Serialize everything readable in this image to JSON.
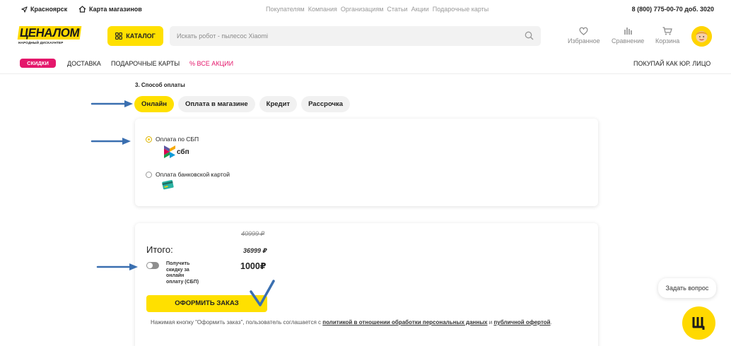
{
  "topbar": {
    "city": "Красноярск",
    "stores": "Карта магазинов",
    "links": [
      "Покупателям",
      "Компания",
      "Организациям",
      "Статьи",
      "Акции",
      "Подарочные карты"
    ],
    "phone": "8 (800) 775-00-70 доб. 3020"
  },
  "header": {
    "logo_main": "ЦЕНАЛОМ",
    "logo_sub": "НАРОДНЫЙ ДИСКАУНТЕР",
    "catalog_label": "КАТАЛОГ",
    "search_placeholder": "Искать робот - пылесос Xiaomi",
    "favorites_label": "Избранное",
    "compare_label": "Сравнение",
    "cart_label": "Корзина"
  },
  "nav": {
    "sale": "СКИДКИ",
    "delivery": "ДОСТАВКА",
    "gift_cards": "ПОДАРОЧНЫЕ КАРТЫ",
    "all_promos": "% ВСЕ АКЦИИ",
    "legal": "ПОКУПАЙ КАК ЮР. ЛИЦО"
  },
  "payment": {
    "section_title": "3. Способ оплаты",
    "tabs": [
      {
        "label": "Онлайн",
        "active": true
      },
      {
        "label": "Оплата в магазине",
        "active": false
      },
      {
        "label": "Кредит",
        "active": false
      },
      {
        "label": "Рассрочка",
        "active": false
      }
    ],
    "options": [
      {
        "label": "Оплата по СБП",
        "selected": true,
        "logo_text": "сбп"
      },
      {
        "label": "Оплата банковской картой",
        "selected": false
      }
    ]
  },
  "total": {
    "label": "Итого:",
    "old_price": "40999 ₽",
    "price": "36999 ₽",
    "discount_price": "1000₽",
    "toggle_label": "Получить скидку за онлайн оплату (СБП)",
    "toggle_on": false,
    "submit_label": "ОФОРМИТЬ ЗАКАЗ",
    "notice_text": "Нажимая кнопку \"Оформить заказ\", пользователь соглашается с",
    "notice_link1": "политикой в отношении обработки персональных данных",
    "notice_and": "и",
    "notice_link2": "публичной офертой",
    "notice_end": "."
  },
  "chat": {
    "ask_label": "Задать вопрос"
  },
  "colors": {
    "brand_yellow": "#ffe000",
    "sale_pink": "#e4176b",
    "annotation_blue": "#3a6fb0"
  }
}
